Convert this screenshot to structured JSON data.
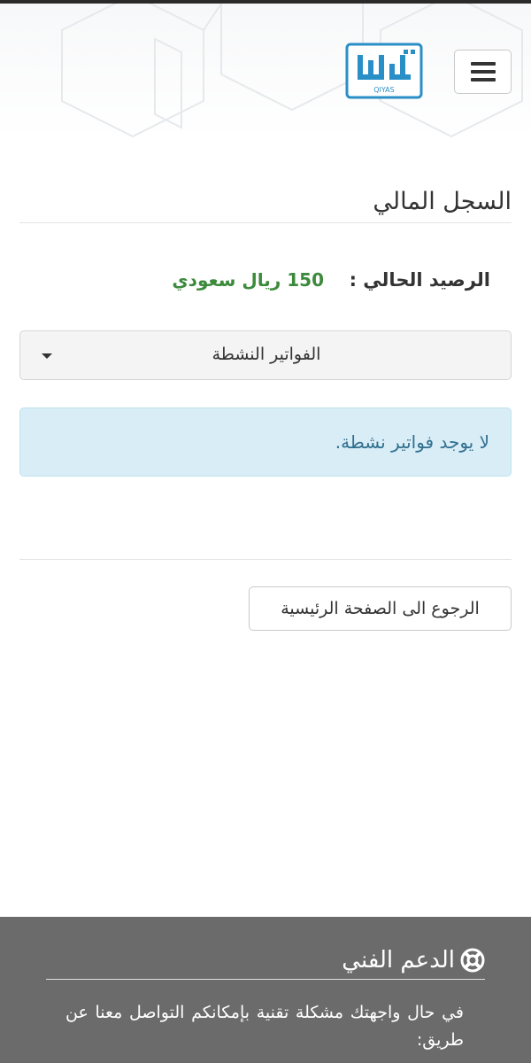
{
  "header": {
    "logo_text": "QIYAS",
    "menu_icon": "hamburger-icon"
  },
  "page": {
    "title": "السجل المالي"
  },
  "balance": {
    "label": "الرصيد الحالي :",
    "value": "150 ريال سعودي",
    "value_color": "#3c8a3c"
  },
  "filter": {
    "selected": "الفواتير النشطة"
  },
  "alert": {
    "message": "لا يوجد فواتير نشطة."
  },
  "actions": {
    "back_label": "الرجوع الى الصفحة الرئيسية"
  },
  "footer": {
    "title": "الدعم الفني",
    "icon": "life-ring-icon",
    "text": "في حال واجهتك مشكلة تقنية بإمكانكم التواصل معنا عن طريق:",
    "background": "#6b6b6b"
  },
  "colors": {
    "alert_bg": "#d9edf7",
    "alert_text": "#31708f",
    "brand_blue": "#2a8fc7"
  }
}
